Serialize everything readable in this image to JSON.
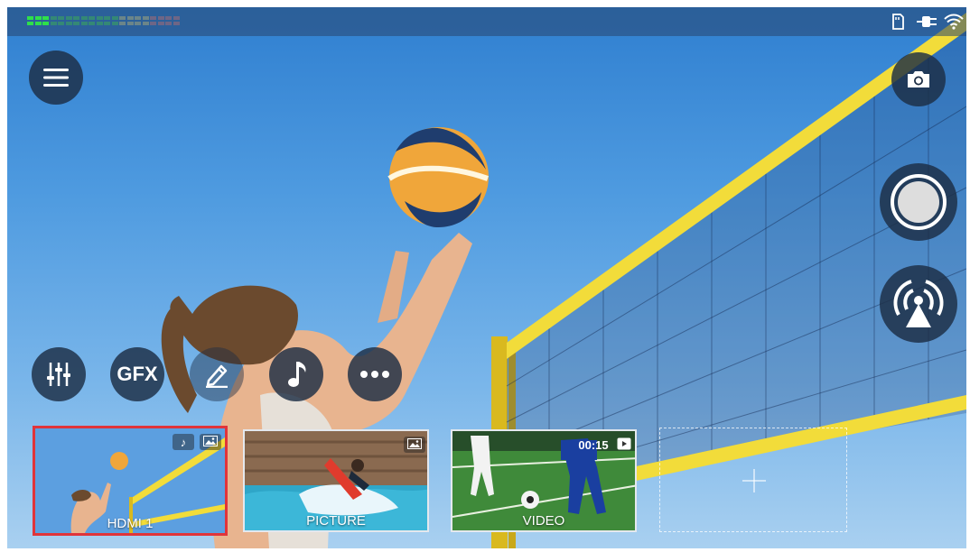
{
  "statusbar": {
    "audio_meter": {
      "level": 0.12,
      "peak": 0.6
    },
    "icons": [
      "sd-card-icon",
      "power-plug-icon",
      "wifi-icon"
    ]
  },
  "left_controls": {
    "menu": "menu-icon",
    "tools": [
      {
        "name": "audio-mixer-button",
        "icon": "mixer-sliders-icon"
      },
      {
        "name": "gfx-button",
        "label": "GFX"
      },
      {
        "name": "annotate-button",
        "icon": "pen-icon"
      },
      {
        "name": "music-button",
        "icon": "music-note-icon"
      },
      {
        "name": "more-button",
        "icon": "more-dots-icon"
      }
    ]
  },
  "right_controls": {
    "snapshot": "camera-icon",
    "record": "record-icon",
    "stream": "broadcast-icon"
  },
  "sources": [
    {
      "label": "HDMI 1",
      "selected": true,
      "badges": [
        "music-note-icon",
        "image-icon"
      ]
    },
    {
      "label": "PICTURE",
      "selected": false,
      "badges": [
        "image-icon"
      ]
    },
    {
      "label": "VIDEO",
      "selected": false,
      "duration": "00:15",
      "badges": [
        "play-icon"
      ]
    }
  ],
  "add_source": {
    "icon": "plus-icon"
  },
  "colors": {
    "accent_selected": "#e0343a",
    "button_bg": "#1c2d44"
  }
}
